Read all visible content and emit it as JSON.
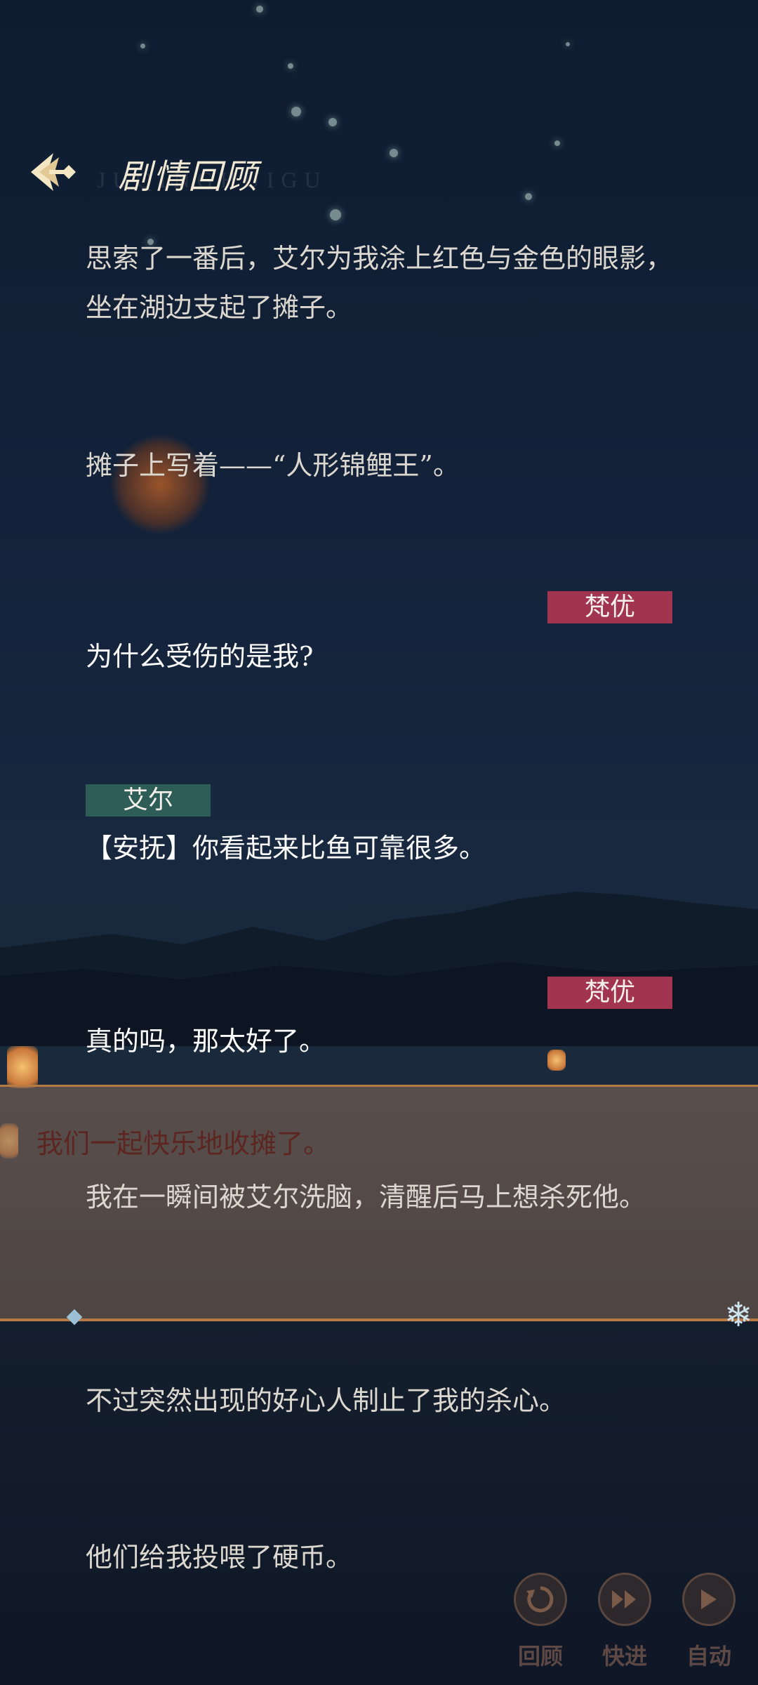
{
  "header": {
    "title": "剧情回顾",
    "subtitle": "JUQINGHUIGU"
  },
  "entries": {
    "e1": "思索了一番后，艾尔为我涂上红色与金色的眼影，坐在湖边支起了摊子。",
    "e2": "摊子上写着——“人形锦鲤王”。",
    "e3": "为什么受伤的是我?",
    "e4": "【安抚】你看起来比鱼可靠很多。",
    "e5": "真的吗，那太好了。",
    "e6": "我在一瞬间被艾尔洗脑，清醒后马上想杀死他。",
    "e7": "不过突然出现的好心人制止了我的杀心。",
    "e8": "他们给我投喂了硬币。"
  },
  "speakers": {
    "s1": "梵优",
    "s2": "艾尔",
    "s3": "梵优"
  },
  "banner": {
    "title": "我们一起快乐地收摊了。"
  },
  "controls": {
    "review": "回顾",
    "fast_forward": "快进",
    "auto": "自动"
  },
  "colors": {
    "speaker_fanyou": "#a1344f",
    "speaker_aier": "#2e5d58",
    "banner_border": "#b87a45"
  }
}
